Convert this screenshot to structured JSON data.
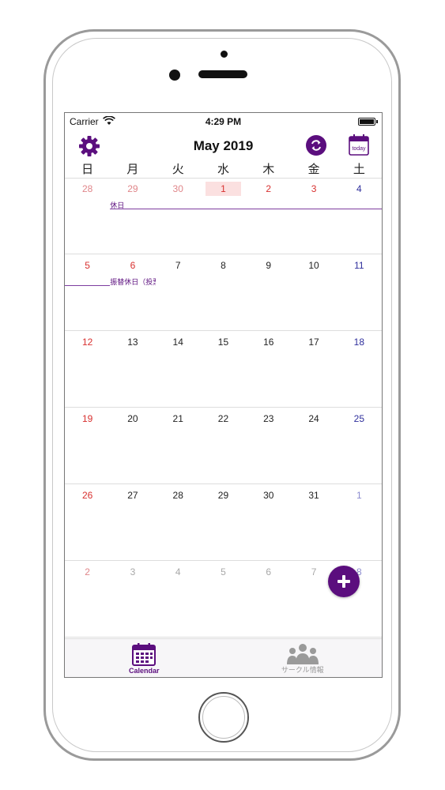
{
  "status_bar": {
    "carrier": "Carrier",
    "time": "4:29 PM"
  },
  "header": {
    "title": "May 2019"
  },
  "weekdays": [
    "日",
    "月",
    "火",
    "水",
    "木",
    "金",
    "土"
  ],
  "weeks": [
    {
      "days": [
        {
          "n": "28",
          "color": "lred"
        },
        {
          "n": "29",
          "color": "lred"
        },
        {
          "n": "30",
          "color": "lred"
        },
        {
          "n": "1",
          "color": "red",
          "today": true
        },
        {
          "n": "2",
          "color": "red"
        },
        {
          "n": "3",
          "color": "red"
        },
        {
          "n": "4",
          "color": "blue"
        }
      ]
    },
    {
      "days": [
        {
          "n": "5",
          "color": "red"
        },
        {
          "n": "6",
          "color": "red"
        },
        {
          "n": "7",
          "color": "black"
        },
        {
          "n": "8",
          "color": "black"
        },
        {
          "n": "9",
          "color": "black"
        },
        {
          "n": "10",
          "color": "black"
        },
        {
          "n": "11",
          "color": "blue"
        }
      ]
    },
    {
      "days": [
        {
          "n": "12",
          "color": "red"
        },
        {
          "n": "13",
          "color": "black"
        },
        {
          "n": "14",
          "color": "black"
        },
        {
          "n": "15",
          "color": "black"
        },
        {
          "n": "16",
          "color": "black"
        },
        {
          "n": "17",
          "color": "black"
        },
        {
          "n": "18",
          "color": "blue"
        }
      ]
    },
    {
      "days": [
        {
          "n": "19",
          "color": "red"
        },
        {
          "n": "20",
          "color": "black"
        },
        {
          "n": "21",
          "color": "black"
        },
        {
          "n": "22",
          "color": "black"
        },
        {
          "n": "23",
          "color": "black"
        },
        {
          "n": "24",
          "color": "black"
        },
        {
          "n": "25",
          "color": "blue"
        }
      ]
    },
    {
      "days": [
        {
          "n": "26",
          "color": "red"
        },
        {
          "n": "27",
          "color": "black"
        },
        {
          "n": "28",
          "color": "black"
        },
        {
          "n": "29",
          "color": "black"
        },
        {
          "n": "30",
          "color": "black"
        },
        {
          "n": "31",
          "color": "black"
        },
        {
          "n": "1",
          "color": "lblue"
        }
      ]
    },
    {
      "days": [
        {
          "n": "2",
          "color": "lred"
        },
        {
          "n": "3",
          "color": "grey"
        },
        {
          "n": "4",
          "color": "grey"
        },
        {
          "n": "5",
          "color": "grey"
        },
        {
          "n": "6",
          "color": "grey"
        },
        {
          "n": "7",
          "color": "grey"
        },
        {
          "n": "8",
          "color": "lblue"
        }
      ]
    }
  ],
  "events": [
    {
      "label": "休日",
      "week": 0,
      "start_day": 1
    },
    {
      "label": "振替休日（投票",
      "week": 1,
      "start_day": 1
    }
  ],
  "tabs": [
    {
      "label": "Calendar",
      "icon": "calendar-icon",
      "active": true
    },
    {
      "label": "サークル情報",
      "icon": "group-icon",
      "active": false
    }
  ],
  "colors": {
    "accent": "#5b0e7e",
    "sunday_holiday": "#d8302f",
    "saturday": "#2f2f9c",
    "today_highlight": "#fbe0e0"
  }
}
